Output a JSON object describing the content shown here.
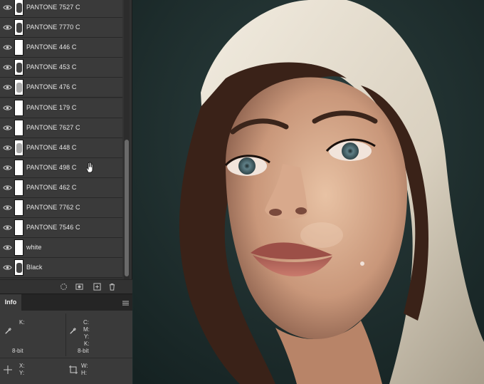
{
  "layers_panel": {
    "layers": [
      {
        "name": "PANTONE 7527 C",
        "thumb": "art"
      },
      {
        "name": "PANTONE 7770 C",
        "thumb": "art"
      },
      {
        "name": "PANTONE 446 C",
        "thumb": "blank"
      },
      {
        "name": "PANTONE 453 C",
        "thumb": "art"
      },
      {
        "name": "PANTONE 476 C",
        "thumb": "light"
      },
      {
        "name": "PANTONE 179 C",
        "thumb": "blank"
      },
      {
        "name": "PANTONE 7627 C",
        "thumb": "blank"
      },
      {
        "name": "PANTONE 448 C",
        "thumb": "light"
      },
      {
        "name": "PANTONE 498 C",
        "thumb": "blank"
      },
      {
        "name": "PANTONE 462 C",
        "thumb": "blank"
      },
      {
        "name": "PANTONE 7762 C",
        "thumb": "blank"
      },
      {
        "name": "PANTONE 7546 C",
        "thumb": "blank"
      },
      {
        "name": "white",
        "thumb": "blank"
      },
      {
        "name": "Black",
        "thumb": "art"
      }
    ],
    "footer_icons": [
      "adjustment-layer-icon",
      "layer-mask-icon",
      "new-layer-icon",
      "trash-icon"
    ]
  },
  "info_panel": {
    "tab_label": "Info",
    "left_readout": {
      "k_label": "K:",
      "bit_depth": "8-bit"
    },
    "right_readout": {
      "c_label": "C:",
      "m_label": "M:",
      "y_label": "Y:",
      "k_label": "K:",
      "bit_depth": "8-bit"
    },
    "position": {
      "x_label": "X:",
      "y_label": "Y:"
    },
    "size": {
      "w_label": "W:",
      "h_label": "H:"
    }
  },
  "colors": {
    "panel_bg": "#323232",
    "row_bg": "#3a3a3a",
    "photo_bg": "#1b2a2a"
  }
}
